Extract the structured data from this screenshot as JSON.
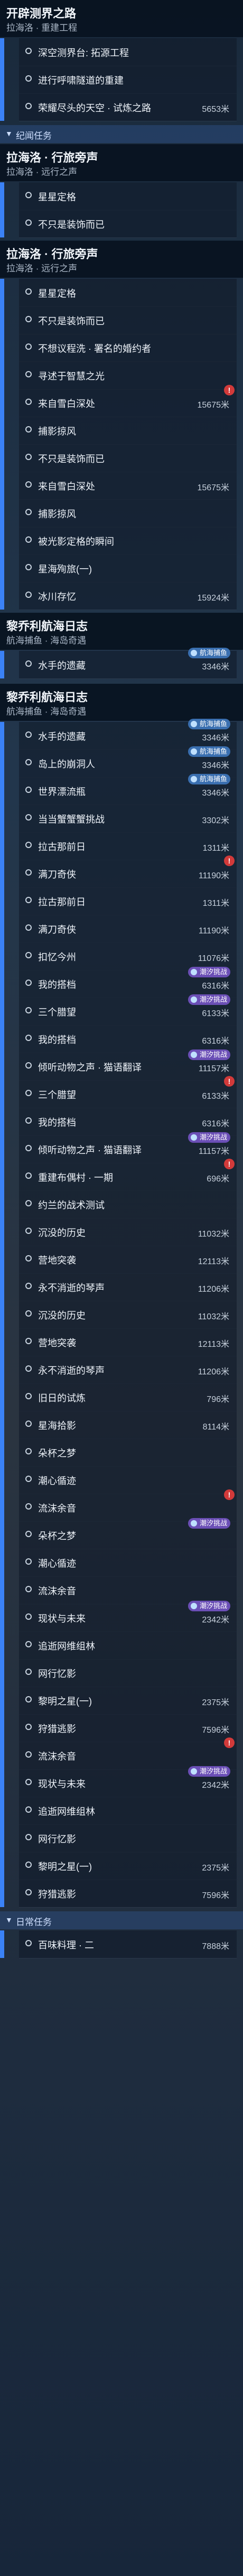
{
  "sections": [
    {
      "id": "s1",
      "title": "开辟测界之路",
      "sub": "拉海洛 · 重建工程"
    },
    {
      "id": "s2",
      "title": "拉海洛 · 行旅旁声",
      "sub": "拉海洛 · 远行之声"
    },
    {
      "id": "s3",
      "title": "拉海洛 · 行旅旁声",
      "sub": "拉海洛 · 远行之声"
    },
    {
      "id": "s4",
      "title": "黎乔利航海日志",
      "sub": "航海捕鱼 · 海岛奇遇"
    },
    {
      "id": "s5",
      "title": "黎乔利航海日志",
      "sub": "航海捕鱼 · 海岛奇遇"
    }
  ],
  "tags": {
    "daily": "纪闻任务",
    "daily2": "日常任务"
  },
  "rows": {
    "s1": [
      {
        "name": "深空测界台: 拓源工程",
        "dist": ""
      },
      {
        "name": "进行呼啸隧道的重建",
        "dist": ""
      },
      {
        "name": "荣耀尽头的天空 · 试炼之路",
        "dist": "5653米"
      }
    ],
    "s2": [
      {
        "name": "星星定格",
        "dist": ""
      },
      {
        "name": "不只是装饰而已",
        "dist": ""
      }
    ],
    "s3": [
      {
        "name": "星星定格",
        "dist": ""
      },
      {
        "name": "不只是装饰而已",
        "dist": ""
      },
      {
        "name": "不想议程洗 · 署名的婚约者",
        "dist": ""
      },
      {
        "name": "寻述于智慧之光",
        "dist": ""
      },
      {
        "name": "来自雪白深处",
        "dist": "15675米"
      },
      {
        "name": "捕影掠风",
        "dist": ""
      },
      {
        "name": "不只是装饰而已",
        "dist": ""
      },
      {
        "name": "来自雪白深处",
        "dist": "15675米"
      },
      {
        "name": "捕影掠风",
        "dist": ""
      },
      {
        "name": "被光影定格的瞬间",
        "dist": ""
      },
      {
        "name": "星海殉旅(一)",
        "dist": ""
      },
      {
        "name": "冰川存忆",
        "dist": "15924米"
      }
    ],
    "s4": [
      {
        "name": "水手的遗藏",
        "dist": "3346米"
      }
    ],
    "s5": [
      {
        "name": "水手的遗藏",
        "dist": "3346米"
      },
      {
        "name": "岛上的崩洞人",
        "dist": "3346米"
      },
      {
        "name": "世界漂流瓶",
        "dist": "3346米"
      },
      {
        "name": "当当蟹蟹蟹挑战",
        "dist": "3302米"
      },
      {
        "name": "拉古那前日",
        "dist": "1311米"
      },
      {
        "name": "满刀奇侠",
        "dist": "11190米"
      },
      {
        "name": "拉古那前日",
        "dist": "1311米"
      },
      {
        "name": "满刀奇侠",
        "dist": "11190米"
      },
      {
        "name": "扣忆今州",
        "dist": "11076米"
      },
      {
        "name": "我的搭档",
        "dist": "6316米"
      },
      {
        "name": "三个腊望",
        "dist": "6133米"
      },
      {
        "name": "我的搭档",
        "dist": "6316米"
      },
      {
        "name": "倾听动物之声 · 猫语翻译",
        "dist": "11157米"
      },
      {
        "name": "三个腊望",
        "dist": "6133米"
      },
      {
        "name": "我的搭档",
        "dist": "6316米"
      },
      {
        "name": "倾听动物之声 · 猫语翻译",
        "dist": "11157米"
      },
      {
        "name": "重建布偶村 · 一期",
        "dist": "696米"
      },
      {
        "name": "约兰的战术测试",
        "dist": ""
      },
      {
        "name": "沉没的历史",
        "dist": "11032米"
      },
      {
        "name": "营地突袭",
        "dist": "12113米"
      },
      {
        "name": "永不消逝的琴声",
        "dist": "11206米"
      },
      {
        "name": "沉没的历史",
        "dist": "11032米"
      },
      {
        "name": "营地突袭",
        "dist": "12113米"
      },
      {
        "name": "永不消逝的琴声",
        "dist": "11206米"
      },
      {
        "name": "旧日的试炼",
        "dist": "796米"
      },
      {
        "name": "星海拾影",
        "dist": "8114米"
      },
      {
        "name": "朵杯之梦",
        "dist": ""
      },
      {
        "name": "潮心循迹",
        "dist": ""
      },
      {
        "name": "流沫余音",
        "dist": ""
      },
      {
        "name": "朵杯之梦",
        "dist": ""
      },
      {
        "name": "潮心循迹",
        "dist": ""
      },
      {
        "name": "流沫余音",
        "dist": ""
      },
      {
        "name": "现状与未来",
        "dist": "2342米"
      },
      {
        "name": "追逝网维组林",
        "dist": ""
      },
      {
        "name": "网行忆影",
        "dist": ""
      },
      {
        "name": "黎明之星(一)",
        "dist": "2375米"
      },
      {
        "name": "狩猎逃影",
        "dist": "7596米"
      },
      {
        "name": "流沫余音",
        "dist": ""
      },
      {
        "name": "现状与未来",
        "dist": "2342米"
      },
      {
        "name": "追逝网维组林",
        "dist": ""
      },
      {
        "name": "网行忆影",
        "dist": ""
      },
      {
        "name": "黎明之星(一)",
        "dist": "2375米"
      },
      {
        "name": "狩猎逃影",
        "dist": "7596米"
      }
    ],
    "daily": [
      {
        "name": "百味料理 · 二",
        "dist": "7888米"
      }
    ]
  },
  "badges": {
    "blue": "航海捕鱼",
    "purple": "潮汐挑战"
  }
}
